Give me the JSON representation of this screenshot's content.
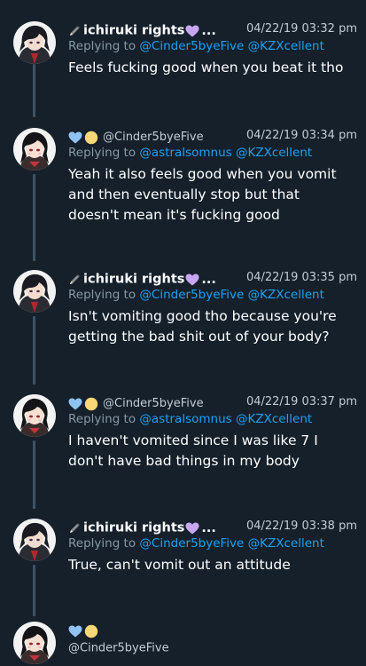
{
  "tweets": [
    {
      "name": "ichiruki rights",
      "ellipsis": "...",
      "time": "04/22/19 03:32 pm",
      "reply_prefix": "Replying to",
      "mentions": [
        "@Cinder5byeFive",
        "@KZXcellent"
      ],
      "text": "Feels fucking good when you beat it tho"
    },
    {
      "handle": "@Cinder5byeFive",
      "time": "04/22/19 03:34 pm",
      "reply_prefix": "Replying to",
      "mentions": [
        "@astralsomnus",
        "@KZXcellent"
      ],
      "text_lines": [
        "Yeah it also feels good when you vomit",
        "and then eventually stop but that",
        "doesn't mean it's fucking good"
      ]
    },
    {
      "name": "ichiruki rights",
      "ellipsis": "...",
      "time": "04/22/19 03:35 pm",
      "reply_prefix": "Replying to",
      "mentions": [
        "@Cinder5byeFive",
        "@KZXcellent"
      ],
      "text_lines": [
        "Isn't vomiting good tho because you're",
        "getting the bad shit out of your body?"
      ]
    },
    {
      "handle": "@Cinder5byeFive",
      "time": "04/22/19 03:37 pm",
      "reply_prefix": "Replying to",
      "mentions": [
        "@astralsomnus",
        "@KZXcellent"
      ],
      "text_lines": [
        "I haven't vomited since I was like 7 I",
        "don't have bad things in my body"
      ]
    },
    {
      "name": "ichiruki rights",
      "ellipsis": "...",
      "time": "04/22/19 03:38 pm",
      "reply_prefix": "Replying to",
      "mentions": [
        "@Cinder5byeFive",
        "@KZXcellent"
      ],
      "text": "True, can't vomit out an attitude"
    },
    {
      "handle": "@Cinder5byeFive"
    }
  ],
  "icons": {
    "pen": "pen-icon",
    "purple_heart": "purple-heart-icon",
    "blue_heart": "blue-heart-icon",
    "yellow_heart": "yellow-heart-icon"
  },
  "colors": {
    "background": "#15202b",
    "mention": "#1da1f2",
    "muted": "#8899a6",
    "thread_line": "#3d5466",
    "purple_heart": "#c9a6f2",
    "blue_heart": "#8fc4f2",
    "yellow_heart": "#f7d776"
  }
}
